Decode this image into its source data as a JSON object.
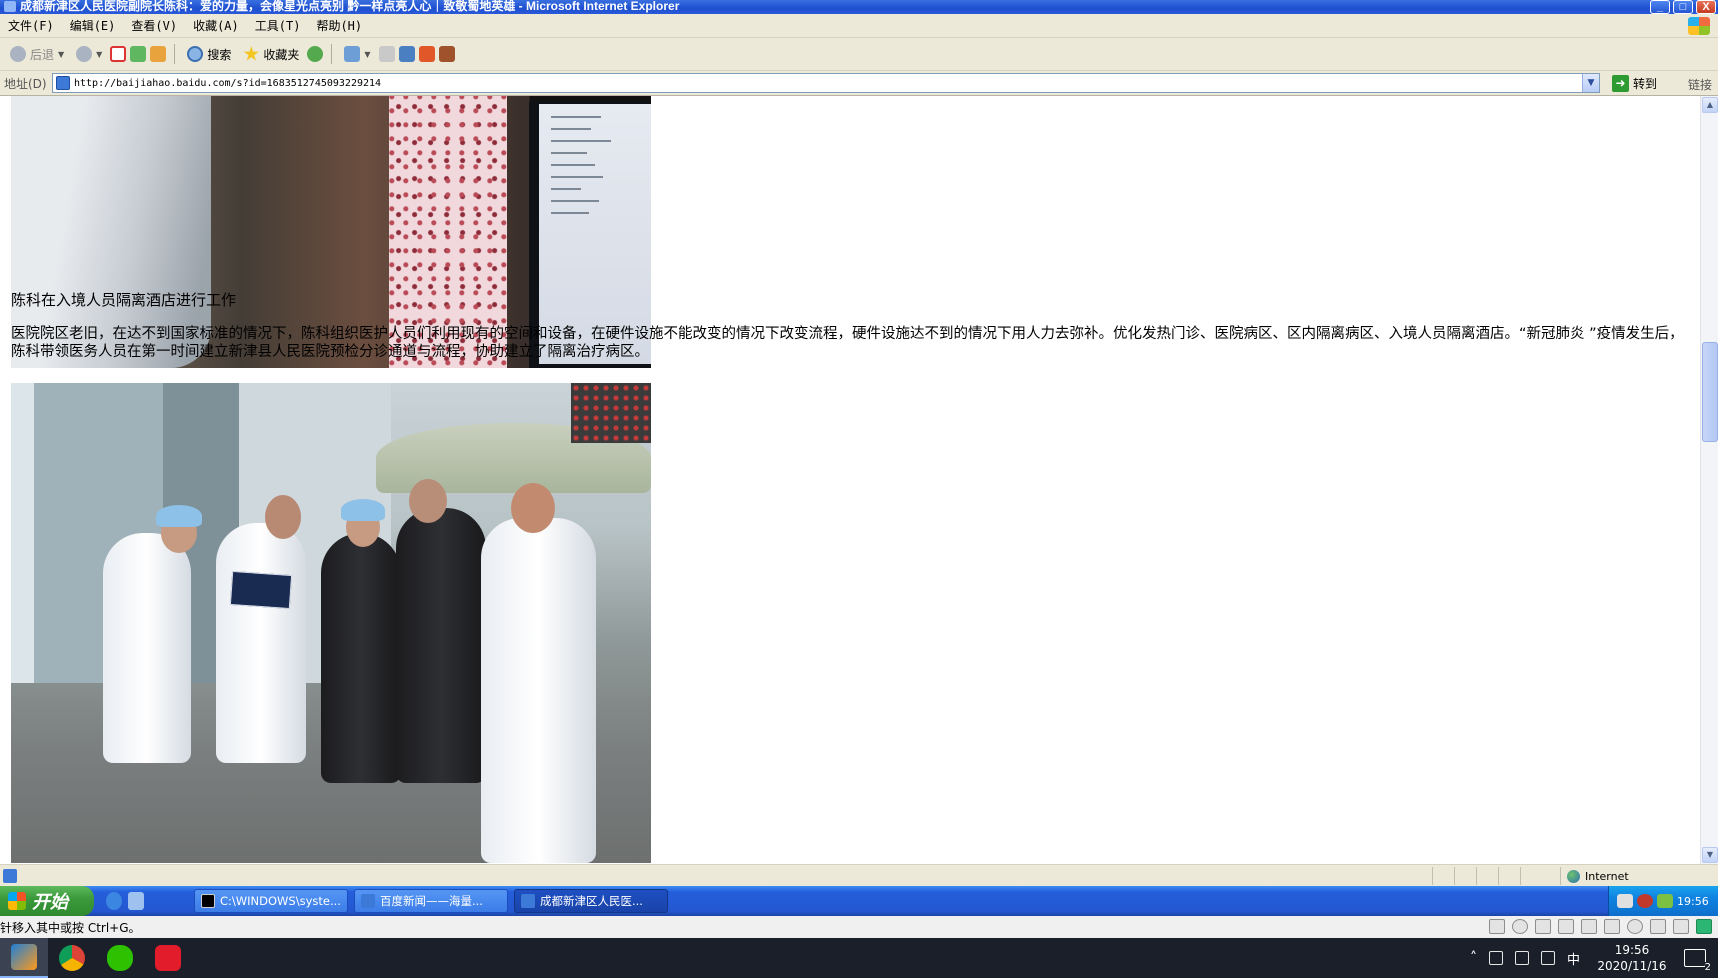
{
  "window": {
    "title": "成都新津区人民医院副院长陈科：爱的力量，会像星光点亮别 黔一样点亮人心｜致敬蜀地英雄 - Microsoft Internet Explorer",
    "controls": [
      "_",
      "□",
      "X"
    ]
  },
  "menu": [
    "文件(F)",
    "编辑(E)",
    "查看(V)",
    "收藏(A)",
    "工具(T)",
    "帮助(H)"
  ],
  "toolbar": {
    "back_label": "后退",
    "search_label": "搜索",
    "favorites_label": "收藏夹"
  },
  "address": {
    "label": "地址(D)",
    "url": "http://baijiahao.baidu.com/s?id=1683512745093229214",
    "go_label": "转到",
    "links_label": "链接"
  },
  "article": {
    "caption": "陈科在入境人员隔离酒店进行工作",
    "paragraph": "医院院区老旧，在达不到国家标准的情况下，陈科组织医护人员们利用现有的空间和设备，在硬件设施不能改变的情况下改变流程，硬件设施达不到的情况下用人力去弥补。优化发热门诊、医院病区、区内隔离病区、入境人员隔离酒店。“新冠肺炎 ”疫情发生后，陈科带领医务人员在第一时间建立新津县人民医院预检分诊通道与流程，协助建立了隔离治疗病区。"
  },
  "status": {
    "zone": "Internet"
  },
  "xp_taskbar": {
    "start_label": "开始",
    "tasks": [
      {
        "label": "C:\\WINDOWS\\syste...",
        "active": false
      },
      {
        "label": "百度新闻——海量...",
        "active": false
      },
      {
        "label": "成都新津区人民医...",
        "active": true
      }
    ],
    "clock": "19:56"
  },
  "hint": {
    "text": "针移入其中或按 Ctrl+G。"
  },
  "host_taskbar": {
    "ime": "中",
    "time": "19:56",
    "date": "2020/11/16",
    "notifications": "2"
  },
  "colors": {
    "xp_blue": "#245edb",
    "xp_chrome": "#ece9d8",
    "start_green": "#3c9a3c",
    "host_taskbar": "#1b1f2a"
  }
}
